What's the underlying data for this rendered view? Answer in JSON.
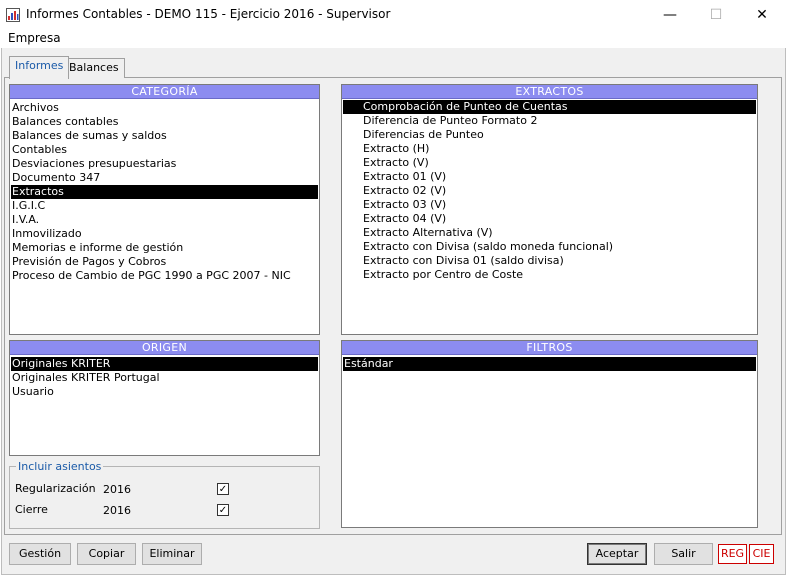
{
  "window": {
    "title": "Informes Contables - DEMO 115 - Ejercicio 2016 - Supervisor",
    "minimize_glyph": "—",
    "maximize_glyph": "☐",
    "close_glyph": "✕",
    "app_icon": "chart-app-icon"
  },
  "menubar": {
    "items": [
      "Empresa"
    ]
  },
  "tabs": [
    {
      "label": "Informes",
      "active": true
    },
    {
      "label": "Balances",
      "active": false
    }
  ],
  "categoria": {
    "header": "CATEGORÍA",
    "items": [
      "Archivos",
      "Balances contables",
      "Balances de sumas y saldos",
      "Contables",
      "Desviaciones presupuestarias",
      "Documento 347",
      "Extractos",
      "I.G.I.C",
      "I.V.A.",
      "Inmovilizado",
      "Memorias e informe de gestión",
      "Previsión de Pagos y Cobros",
      "Proceso de Cambio de PGC 1990 a PGC 2007 - NIC"
    ],
    "selected": "Extractos"
  },
  "extractos": {
    "header": "EXTRACTOS",
    "items": [
      "Comprobación de Punteo de Cuentas",
      "Diferencia de Punteo Formato 2",
      "Diferencias de Punteo",
      "Extracto (H)",
      "Extracto (V)",
      "Extracto 01 (V)",
      "Extracto 02 (V)",
      "Extracto 03 (V)",
      "Extracto 04 (V)",
      "Extracto Alternativa (V)",
      "Extracto con Divisa (saldo moneda funcional)",
      "Extracto con Divisa 01 (saldo divisa)",
      "Extracto por Centro de Coste"
    ],
    "selected": "Comprobación de Punteo de Cuentas"
  },
  "origen": {
    "header": "ORIGEN",
    "items": [
      "Originales KRITER",
      "Originales KRITER Portugal",
      "Usuario"
    ],
    "selected": "Originales KRITER"
  },
  "filtros": {
    "header": "FILTROS",
    "items": [
      "Estándar"
    ],
    "selected": "Estándar"
  },
  "incluir": {
    "title": "Incluir asientos",
    "rows": [
      {
        "label": "Regularización",
        "year": "2016",
        "checked": true
      },
      {
        "label": "Cierre",
        "year": "2016",
        "checked": true
      }
    ],
    "check_glyph": "✓"
  },
  "buttons": {
    "gestion": "Gestión",
    "copiar": "Copiar",
    "eliminar": "Eliminar",
    "aceptar": "Aceptar",
    "salir": "Salir"
  },
  "status": {
    "reg": "REG",
    "cie": "CIE"
  },
  "colors": {
    "list_header": "#8c8cf0",
    "selection": "#000000",
    "status_text": "#cc0000",
    "tab_text": "#1a5aa8"
  }
}
